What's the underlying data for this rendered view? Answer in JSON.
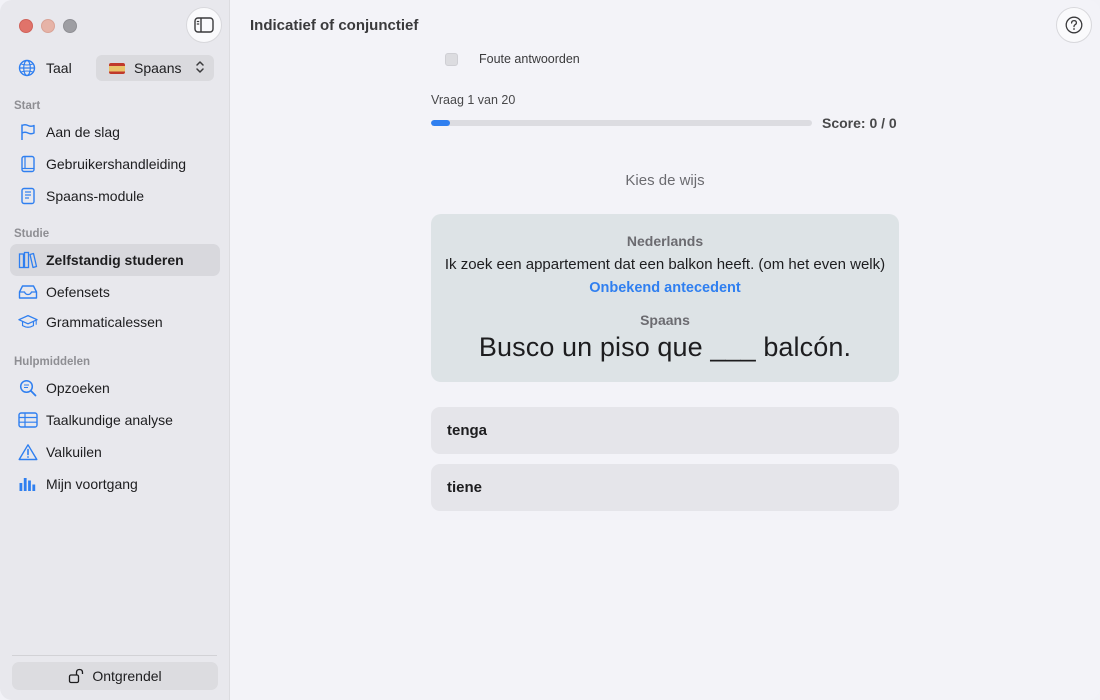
{
  "window": {
    "title": "Indicatief of conjunctief"
  },
  "sidebar": {
    "language": {
      "label": "Taal",
      "selected": "Spaans"
    },
    "sections": [
      {
        "label": "Start",
        "items": [
          {
            "label": "Aan de slag",
            "icon": "flag-icon"
          },
          {
            "label": "Gebruikershandleiding",
            "icon": "book-icon"
          },
          {
            "label": "Spaans-module",
            "icon": "book-closed-icon"
          }
        ]
      },
      {
        "label": "Studie",
        "items": [
          {
            "label": "Zelfstandig studeren",
            "icon": "books-icon",
            "active": true
          },
          {
            "label": "Oefensets",
            "icon": "tray-icon"
          },
          {
            "label": "Grammaticalessen",
            "icon": "graduation-cap-icon"
          }
        ]
      },
      {
        "label": "Hulpmiddelen",
        "items": [
          {
            "label": "Opzoeken",
            "icon": "magnifier-icon"
          },
          {
            "label": "Taalkundige analyse",
            "icon": "table-icon"
          },
          {
            "label": "Valkuilen",
            "icon": "warning-icon"
          },
          {
            "label": "Mijn voortgang",
            "icon": "bar-chart-icon"
          }
        ]
      }
    ],
    "unlock_label": "Ontgrendel"
  },
  "quiz": {
    "wrong_answers_label": "Foute antwoorden",
    "wrong_answers_checked": false,
    "question_label": "Vraag 1 van 20",
    "progress": 0.05,
    "score_label": "Score: 0 / 0",
    "prompt": "Kies de wijs",
    "source_language": "Nederlands",
    "source_sentence": "Ik zoek een appartement dat een balkon heeft. (om het even welk)",
    "hint": "Onbekend antecedent",
    "target_language": "Spaans",
    "target_sentence": "Busco un piso que ___ balcón.",
    "options": [
      "tenga",
      "tiene"
    ]
  },
  "colors": {
    "accent": "#2f7ff0",
    "sidebar_bg": "#e8e8ed",
    "card_bg": "#dde3e6"
  }
}
